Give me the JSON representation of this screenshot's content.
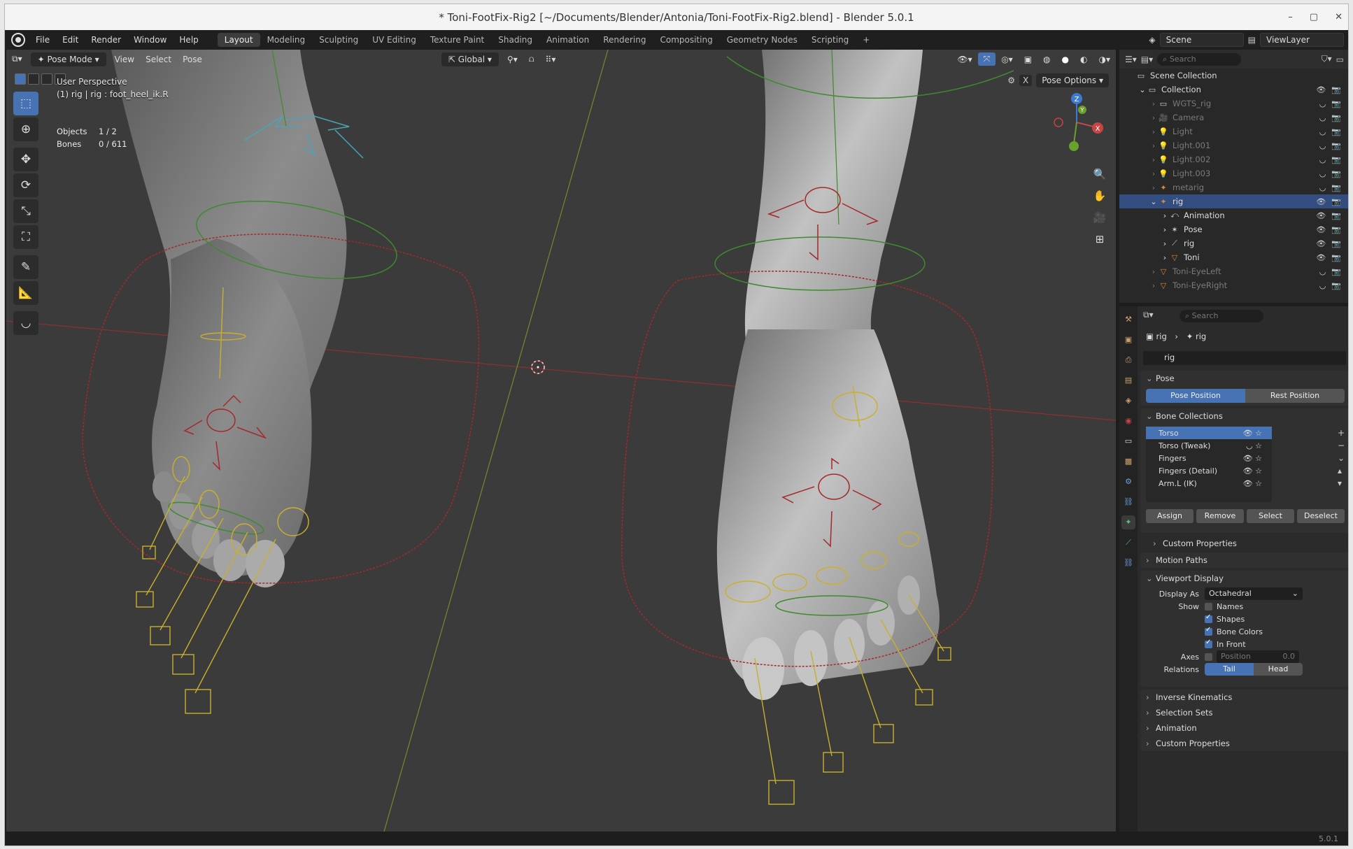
{
  "window": {
    "title": "* Toni-FootFix-Rig2 [~/Documents/Blender/Antonia/Toni-FootFix-Rig2.blend] - Blender 5.0.1",
    "controls": [
      "–",
      "▢",
      "✕"
    ]
  },
  "menubar": {
    "menus": [
      "File",
      "Edit",
      "Render",
      "Window",
      "Help"
    ],
    "workspaces": [
      "Layout",
      "Modeling",
      "Sculpting",
      "UV Editing",
      "Texture Paint",
      "Shading",
      "Animation",
      "Rendering",
      "Compositing",
      "Geometry Nodes",
      "Scripting"
    ],
    "active_workspace": "Layout",
    "scene": "Scene",
    "view_layer": "ViewLayer"
  },
  "viewport": {
    "mode": "Pose Mode",
    "menus": [
      "View",
      "Select",
      "Pose"
    ],
    "transform_orientation": "Global",
    "pose_options": "Pose Options",
    "perspective": "User Perspective",
    "active": "(1) rig | rig : foot_heel_ik.R",
    "stats": [
      {
        "label": "Objects",
        "value": "1 / 2"
      },
      {
        "label": "Bones",
        "value": "0 / 611"
      }
    ],
    "gizmo_axes": [
      "Z",
      "Y",
      "X"
    ],
    "colors": {
      "bg": "#3b3b3b",
      "bone_yellow": "#c8b02c",
      "bone_red": "#a5282a",
      "bone_green": "#3e8a2e",
      "bone_cyan": "#4aa5b5",
      "skin": "#9a9a9a"
    }
  },
  "outliner": {
    "search_placeholder": "Search",
    "rows": [
      {
        "label": "Scene Collection",
        "indent": 0,
        "icon": "collection-icon"
      },
      {
        "label": "Collection",
        "indent": 1,
        "icon": "collection-icon"
      },
      {
        "label": "WGTS_rig",
        "indent": 2,
        "icon": "collection-icon",
        "dim": true
      },
      {
        "label": "Camera",
        "indent": 2,
        "icon": "camera-icon",
        "dim": true
      },
      {
        "label": "Light",
        "indent": 2,
        "icon": "light-icon",
        "dim": true
      },
      {
        "label": "Light.001",
        "indent": 2,
        "icon": "light-icon",
        "dim": true
      },
      {
        "label": "Light.002",
        "indent": 2,
        "icon": "light-icon",
        "dim": true
      },
      {
        "label": "Light.003",
        "indent": 2,
        "icon": "light-icon",
        "dim": true
      },
      {
        "label": "metarig",
        "indent": 2,
        "icon": "armature-icon",
        "dim": true
      },
      {
        "label": "rig",
        "indent": 2,
        "icon": "armature-icon",
        "selected": true
      },
      {
        "label": "Animation",
        "indent": 3,
        "icon": "animation-icon"
      },
      {
        "label": "Pose",
        "indent": 3,
        "icon": "pose-icon"
      },
      {
        "label": "rig",
        "indent": 3,
        "icon": "armature-data-icon"
      },
      {
        "label": "Toni",
        "indent": 3,
        "icon": "mesh-icon"
      },
      {
        "label": "Toni-EyeLeft",
        "indent": 2,
        "icon": "mesh-icon",
        "dim": true
      },
      {
        "label": "Toni-EyeRight",
        "indent": 2,
        "icon": "mesh-icon",
        "dim": true
      }
    ]
  },
  "properties": {
    "search_placeholder": "Search",
    "breadcrumb": [
      "rig",
      "rig"
    ],
    "data_name": "rig",
    "pose_panel": {
      "title": "Pose",
      "pose_position": "Pose Position",
      "rest_position": "Rest Position"
    },
    "bone_collections": {
      "title": "Bone Collections",
      "items": [
        "Torso",
        "Torso (Tweak)",
        "Fingers",
        "Fingers (Detail)",
        "Arm.L (IK)"
      ],
      "buttons": [
        "Assign",
        "Remove",
        "Select",
        "Deselect"
      ],
      "custom_properties": "Custom Properties"
    },
    "motion_paths": "Motion Paths",
    "viewport_display": {
      "title": "Viewport Display",
      "display_as_label": "Display As",
      "display_as_value": "Octahedral",
      "show_label": "Show",
      "show": [
        {
          "label": "Names",
          "checked": false
        },
        {
          "label": "Shapes",
          "checked": true
        },
        {
          "label": "Bone Colors",
          "checked": true
        },
        {
          "label": "In Front",
          "checked": true
        }
      ],
      "axes_label": "Axes",
      "axes_position_label": "Position",
      "axes_position_value": "0.0",
      "relations_label": "Relations",
      "relations_tail": "Tail",
      "relations_head": "Head"
    },
    "collapsed_panels": [
      "Inverse Kinematics",
      "Selection Sets",
      "Animation",
      "Custom Properties"
    ]
  },
  "status": {
    "version": "5.0.1"
  }
}
